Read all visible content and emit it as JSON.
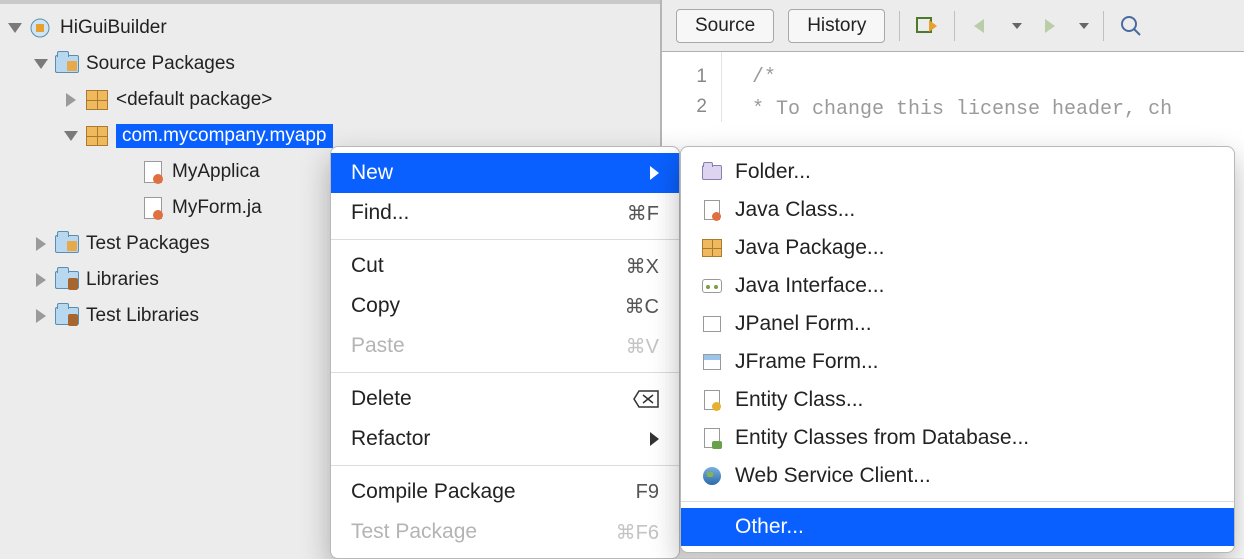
{
  "tree": {
    "project": "HiGuiBuilder",
    "sourcePackages": "Source Packages",
    "defaultPackage": "<default package>",
    "selectedPackage": "com.mycompany.myapp",
    "file1": "MyApplica",
    "file2": "MyForm.ja",
    "testPackages": "Test Packages",
    "libraries": "Libraries",
    "testLibraries": "Test Libraries"
  },
  "editor": {
    "tabSource": "Source",
    "tabHistory": "History",
    "line1": "1",
    "line2": "2",
    "code1": "/*",
    "code2": " * To change this license header, ch"
  },
  "contextMenu": {
    "new": "New",
    "find": "Find...",
    "findKey": "⌘F",
    "cut": "Cut",
    "cutKey": "⌘X",
    "copy": "Copy",
    "copyKey": "⌘C",
    "paste": "Paste",
    "pasteKey": "⌘V",
    "delete": "Delete",
    "deleteKey": "⌫",
    "refactor": "Refactor",
    "compile": "Compile Package",
    "compileKey": "F9",
    "test": "Test Package",
    "testKey": "⌘F6"
  },
  "submenu": {
    "folder": "Folder...",
    "javaClass": "Java Class...",
    "javaPackage": "Java Package...",
    "javaInterface": "Java Interface...",
    "jpanel": "JPanel Form...",
    "jframe": "JFrame Form...",
    "entityClass": "Entity Class...",
    "entityDb": "Entity Classes from Database...",
    "webService": "Web Service Client...",
    "other": "Other..."
  }
}
